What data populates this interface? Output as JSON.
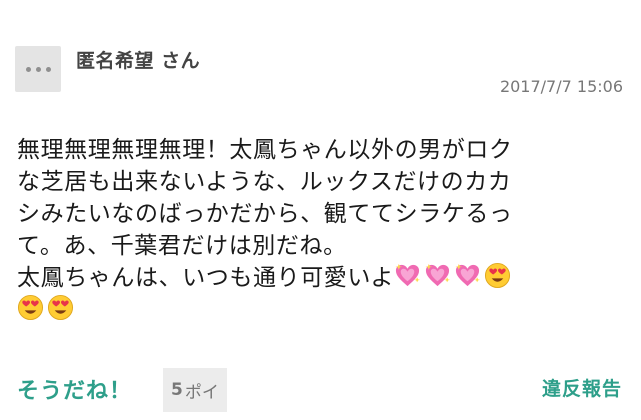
{
  "post": {
    "username": "匿名希望 さん",
    "timestamp": "2017/7/7 15:06",
    "lines": [
      "無理無理無理無理！太鳳ちゃん以外の男がロク",
      "な芝居も出来ないような、ルックスだけのカカ",
      "シみたいなのばっかだから、観ててシラケるっ",
      "て。あ、千葉君だけは別だね。",
      "太鳳ちゃんは、いつも通り可愛いよ"
    ],
    "trailing_emojis": [
      "sparkling-heart",
      "sparkling-heart",
      "sparkling-heart",
      "heart-eyes",
      "heart-eyes",
      "heart-eyes"
    ]
  },
  "actions": {
    "agree_label": "そうだね！",
    "poi_count": "5",
    "poi_unit": "ポイ",
    "report_label": "違反報告"
  },
  "colors": {
    "accent": "#2e9f8a",
    "avatar_bg": "#e4e4e4",
    "poi_bg": "#ececec"
  }
}
